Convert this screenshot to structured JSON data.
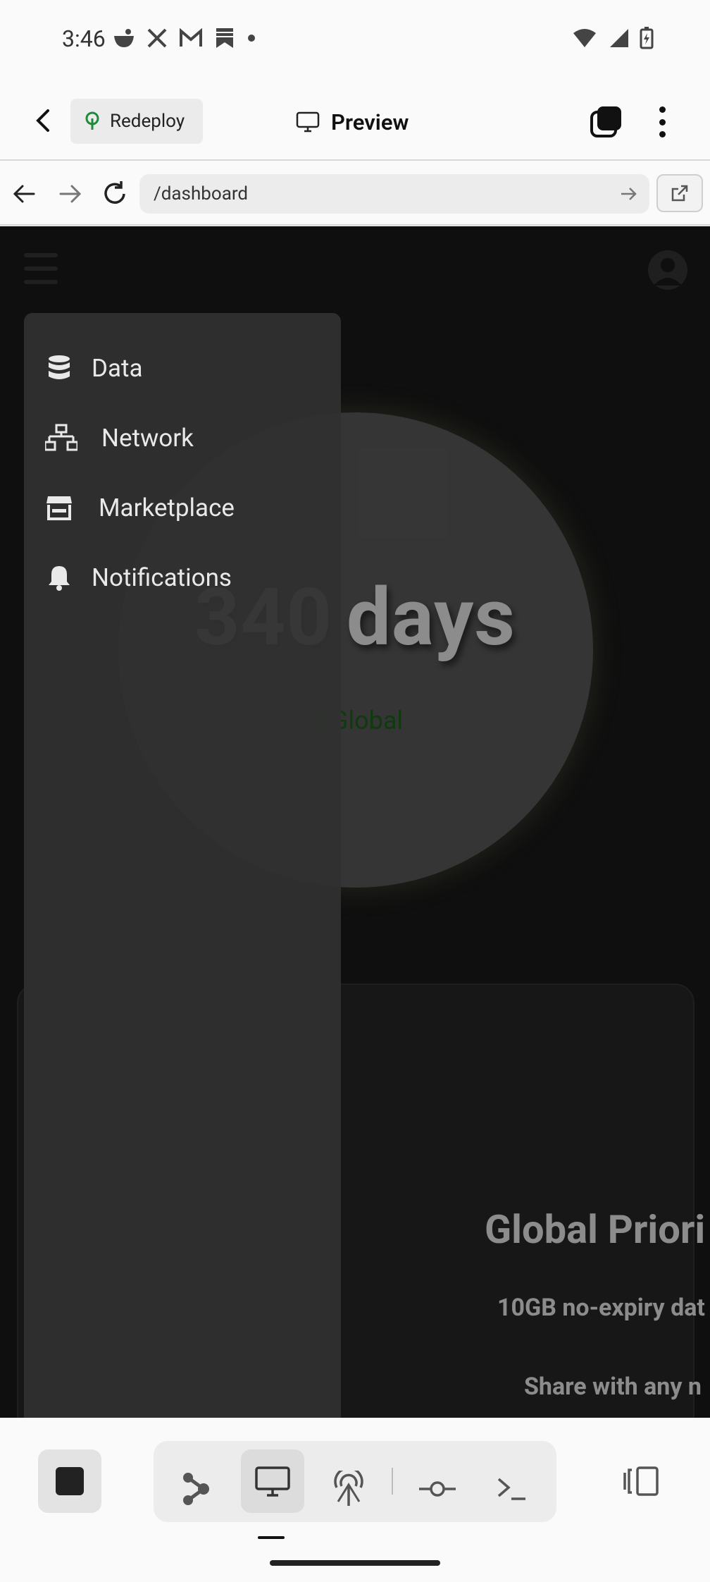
{
  "status_bar": {
    "time": "3:46",
    "left_icons": [
      "bowl-icon",
      "x-logo-icon",
      "gmail-icon",
      "bookmark-icon",
      "dot-icon"
    ],
    "right_icons": [
      "wifi-icon",
      "signal-icon",
      "battery-charging-icon"
    ]
  },
  "app_bar": {
    "back_icon": "chevron-left-icon",
    "redeploy_label": "Redeploy",
    "preview_label": "Preview",
    "tabs_icon": "tabs-icon",
    "menu_icon": "more-vert-icon"
  },
  "url_bar": {
    "url": "/dashboard",
    "back_icon": "arrow-left-icon",
    "forward_icon": "arrow-right-icon",
    "reload_icon": "reload-icon",
    "open_external_icon": "open-external-icon"
  },
  "page": {
    "days_number": "340",
    "days_unit": "days",
    "region_label": "Global",
    "card": {
      "title": "Global Priori",
      "line1": "10GB no-expiry dat",
      "line2": "Share with any n"
    }
  },
  "drawer": {
    "items": [
      {
        "label": "Data",
        "icon": "database-icon"
      },
      {
        "label": "Network",
        "icon": "network-icon"
      },
      {
        "label": "Marketplace",
        "icon": "store-icon"
      },
      {
        "label": "Notifications",
        "icon": "bell-icon"
      }
    ]
  },
  "bottom_bar": {
    "tools": [
      "stop-icon",
      "graph-icon",
      "desktop-icon",
      "antenna-icon",
      "commit-icon",
      "terminal-icon",
      "split-view-icon"
    ]
  },
  "colors": {
    "viewport_bg": "#1c1c1c",
    "circle": "#626262",
    "region_green": "#1a6b1a",
    "drawer_bg": "#303030"
  }
}
